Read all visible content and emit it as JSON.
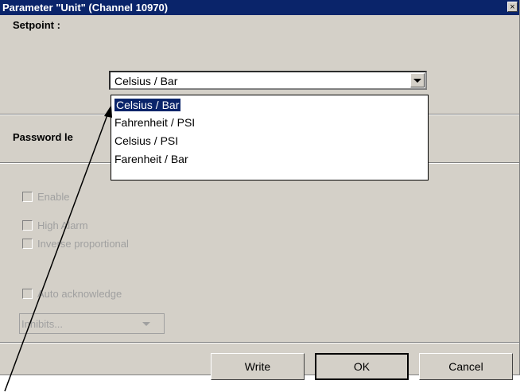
{
  "window": {
    "title": "Parameter \"Unit\" (Channel 10970)",
    "close_glyph": "×"
  },
  "setpoint": {
    "label": "Setpoint :",
    "selected": "Celsius / Bar",
    "options": [
      "Celsius / Bar",
      "Fahrenheit / PSI",
      "Celsius / PSI",
      "Farenheit / Bar"
    ]
  },
  "password": {
    "label": "Password le"
  },
  "checkboxes": {
    "enable": "Enable",
    "high_alarm": "High Alarm",
    "inverse": "Inverse proportional",
    "auto_ack": "Auto acknowledge"
  },
  "inhibits": {
    "value": "Inhibits..."
  },
  "buttons": {
    "write": "Write",
    "ok": "OK",
    "cancel": "Cancel"
  },
  "colors": {
    "titlebar": "#0a246a",
    "dialog_bg": "#d4d0c8",
    "selection": "#0a246a",
    "disabled_text": "#a0a0a0"
  },
  "icons": {
    "close": "close-icon",
    "dropdown": "chevron-down-icon",
    "annotation": "arrow-pointer-icon"
  }
}
